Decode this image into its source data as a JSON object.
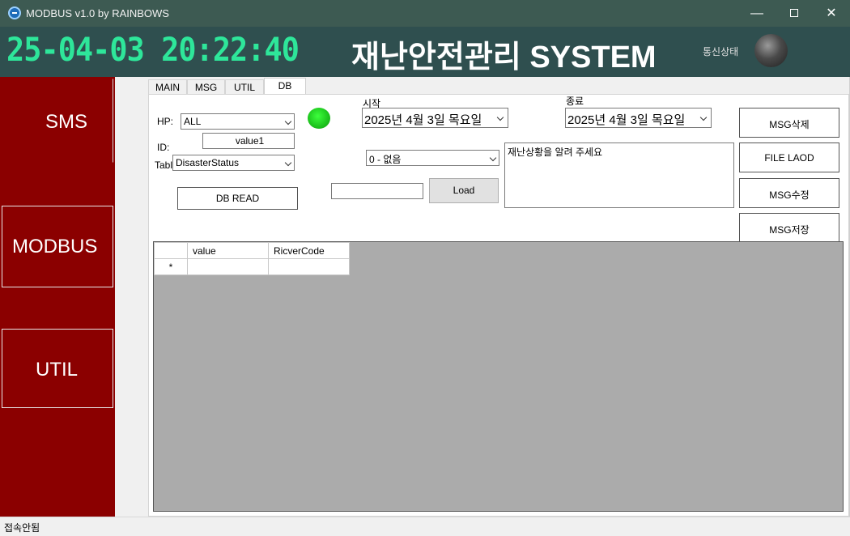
{
  "window": {
    "title": "MODBUS v1.0 by RAINBOWS",
    "minimize": "—",
    "close": "✕"
  },
  "header": {
    "clock": "25-04-03 20:22:40",
    "system_title": "재난안전관리 SYSTEM",
    "comm_status_label": "통신상태",
    "clock_color": "#2ee69a",
    "background_color": "#2f4f4f"
  },
  "nav": {
    "items": [
      {
        "label": "SMS"
      },
      {
        "label": "MODBUS"
      },
      {
        "label": "UTIL"
      }
    ],
    "background_color": "#8b0000"
  },
  "tabs": [
    {
      "label": "MAIN"
    },
    {
      "label": "MSG"
    },
    {
      "label": "UTIL"
    },
    {
      "label": "DB",
      "selected": true
    }
  ],
  "db_panel": {
    "hp_label": "HP:",
    "hp_value": "ALL",
    "id_label": "ID:",
    "id_value": "value1",
    "table_label": "Table",
    "table_value": "DisasterStatus",
    "db_read_button": "DB READ",
    "status_led_color": "#1fc81f",
    "start_label": "시작",
    "start_date": "2025년   4월   3일 목요일",
    "end_label": "종료",
    "end_date": "2025년   4월   3일 목요일",
    "category_value": "0 - 없음",
    "load_input_value": "",
    "load_button": "Load",
    "message_text": "재난상황을 알려 주세요",
    "buttons": {
      "msg_delete": "MSG삭제",
      "file_load": "FILE LAOD",
      "msg_edit": "MSG수정",
      "msg_save": "MSG저장"
    }
  },
  "grid": {
    "columns": [
      "value",
      "RicverCode"
    ],
    "new_row_marker": "*",
    "rows": []
  },
  "statusbar": {
    "text": "접속안됨"
  }
}
